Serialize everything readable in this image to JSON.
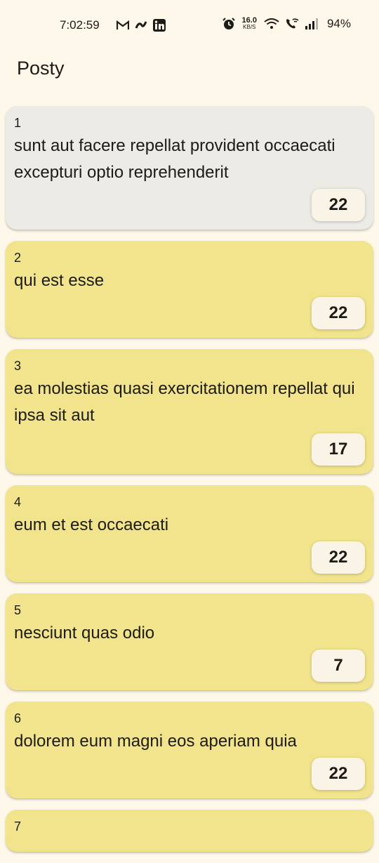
{
  "status_bar": {
    "time": "7:02:59",
    "speed_value": "16.0",
    "speed_unit": "KB/S",
    "battery": "94%"
  },
  "app_bar": {
    "title": "Posty"
  },
  "posts": [
    {
      "id": "1",
      "title": "sunt aut facere repellat provident occaecati excepturi optio reprehenderit",
      "count": "22"
    },
    {
      "id": "2",
      "title": "qui est esse",
      "count": "22"
    },
    {
      "id": "3",
      "title": "ea molestias quasi exercitationem repellat qui ipsa sit aut",
      "count": "17"
    },
    {
      "id": "4",
      "title": "eum et est occaecati",
      "count": "22"
    },
    {
      "id": "5",
      "title": "nesciunt quas odio",
      "count": "7"
    },
    {
      "id": "6",
      "title": "dolorem eum magni eos aperiam quia",
      "count": "22"
    },
    {
      "id": "7"
    }
  ],
  "colors": {
    "background": "#fdf8e9",
    "card": "#f2e48c",
    "card_highlight": "#ecebe6",
    "badge": "#faf4e6"
  }
}
